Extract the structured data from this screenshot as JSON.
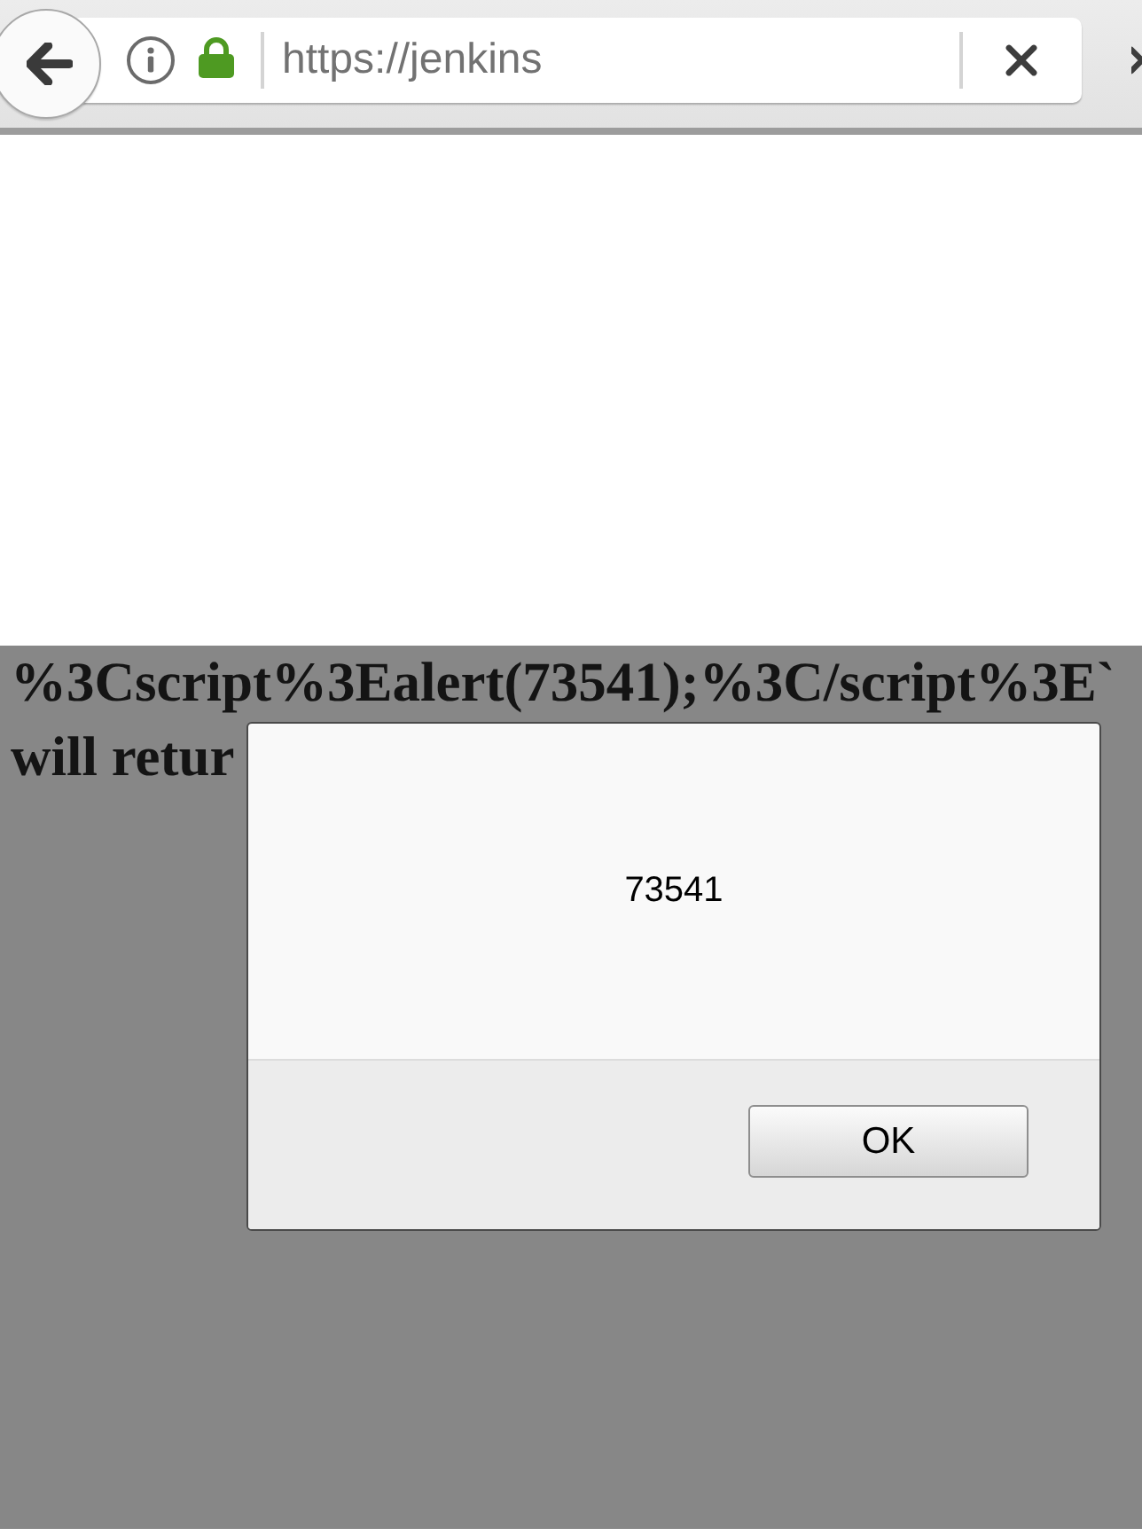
{
  "browser": {
    "url": "https://jenkins"
  },
  "page": {
    "lines": [
      "%3Cscript%3Ealert(73541);%3C/script%3E`",
      "will retur"
    ]
  },
  "alert": {
    "message": "73541",
    "buttons": [
      "OK"
    ]
  }
}
